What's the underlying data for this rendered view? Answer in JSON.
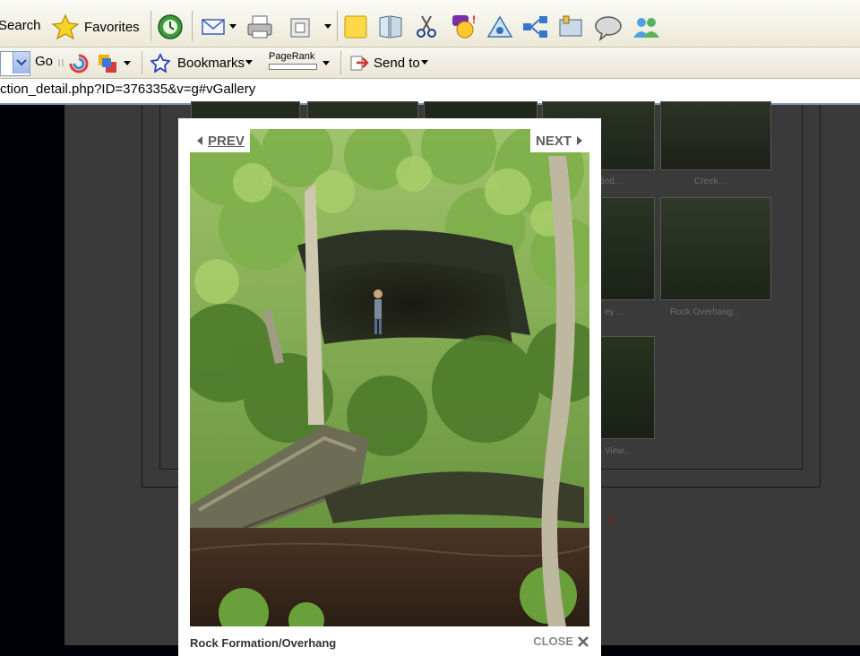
{
  "toolbar1": {
    "search_label": "Search",
    "favorites_label": "Favorites"
  },
  "toolbar2": {
    "go_label": "Go",
    "bookmarks_label": "Bookmarks",
    "pagerank_label": "PageRank",
    "sendto_label": "Send to"
  },
  "address": {
    "url": "ction_detail.php?ID=376335&v=g#vGallery"
  },
  "gallery": {
    "thumb_captions": [
      "Bed...",
      "Creek...",
      "ey ...",
      "Rock Overhang...",
      "View..."
    ]
  },
  "lightbox": {
    "prev_label": "PREV",
    "next_label": "NEXT",
    "caption": "Rock Formation/Overhang",
    "close_label": "CLOSE"
  }
}
